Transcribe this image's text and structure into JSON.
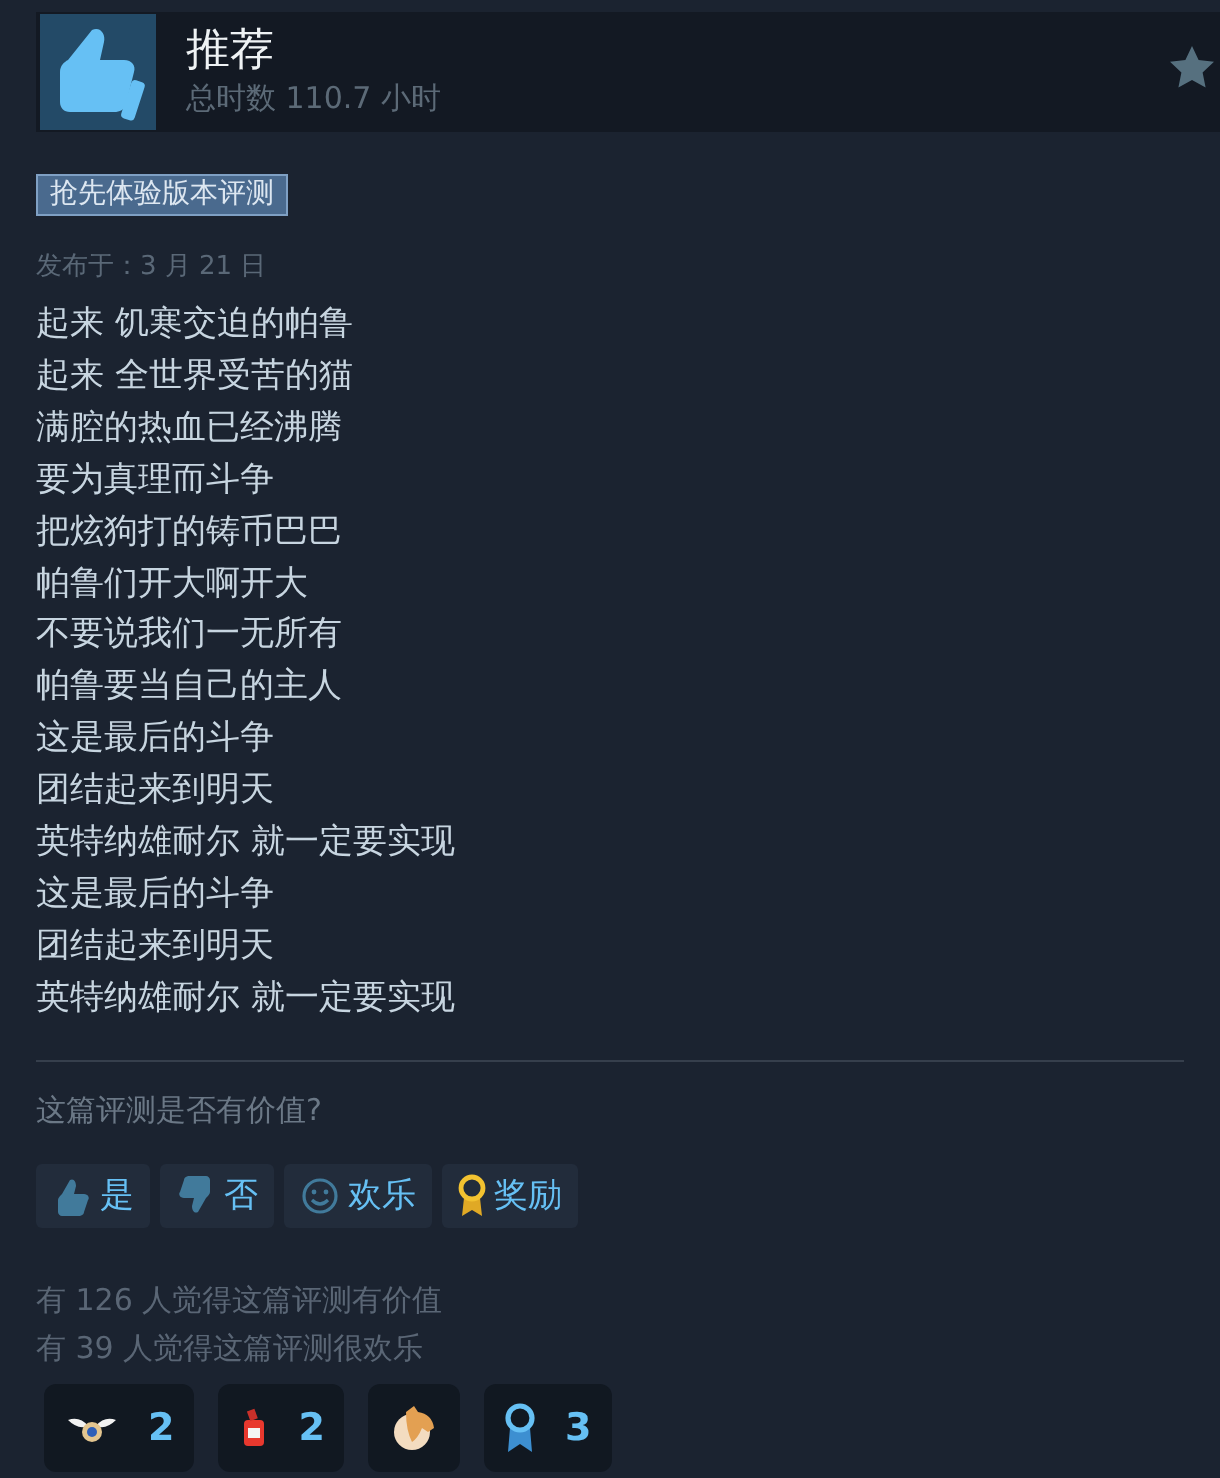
{
  "review": {
    "verdict": "推荐",
    "recommended": true,
    "playtime": "总时数 110.7 小时",
    "tag": "抢先体验版本评测",
    "posted": "发布于：3 月 21 日",
    "lines": [
      "起来 饥寒交迫的帕鲁",
      "起来 全世界受苦的猫",
      "满腔的热血已经沸腾",
      "要为真理而斗争",
      "把炫狗打的铸币巴巴",
      "帕鲁们开大啊开大",
      "不要说我们一无所有",
      "帕鲁要当自己的主人",
      "这是最后的斗争",
      "团结起来到明天",
      "英特纳雄耐尔 就一定要实现",
      "这是最后的斗争",
      "团结起来到明天",
      "英特纳雄耐尔 就一定要实现"
    ]
  },
  "feedback": {
    "question": "这篇评测是否有价值?",
    "buttons": [
      {
        "kind": "yes",
        "label": "是"
      },
      {
        "kind": "no",
        "label": "否"
      },
      {
        "kind": "funny",
        "label": "欢乐"
      },
      {
        "kind": "award",
        "label": "奖励"
      }
    ],
    "stats": [
      "有 126 人觉得这篇评测有价值",
      "有 39 人觉得这篇评测很欢乐"
    ],
    "awards": [
      {
        "kind": "wings",
        "count": "2"
      },
      {
        "kind": "bottle",
        "count": "2"
      },
      {
        "kind": "horse"
      },
      {
        "kind": "ribbon",
        "count": "3"
      }
    ]
  }
}
